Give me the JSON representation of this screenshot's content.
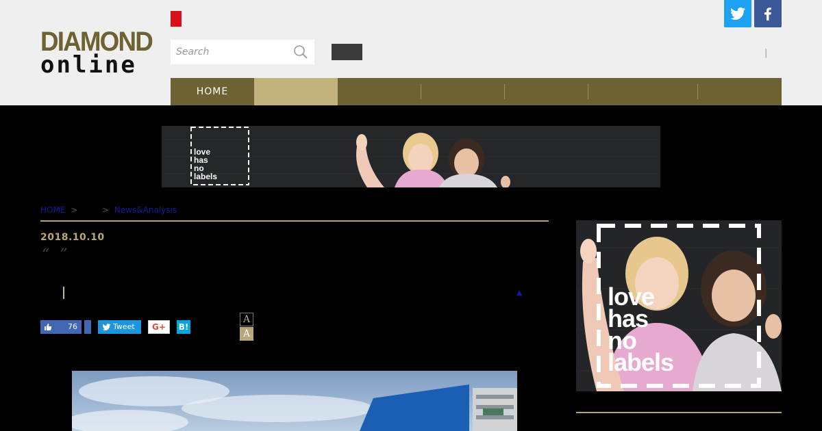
{
  "header": {
    "logo_line1": "DIAMOND",
    "logo_line2": "online",
    "search_placeholder": "Search",
    "separator": "|"
  },
  "nav": {
    "items": [
      {
        "label": "HOME",
        "active": false
      },
      {
        "label": "",
        "active": true
      },
      {
        "label": "",
        "active": false
      },
      {
        "label": "",
        "active": false
      },
      {
        "label": "",
        "active": false
      },
      {
        "label": "",
        "active": false
      },
      {
        "label": "",
        "active": false
      }
    ]
  },
  "ads": {
    "banner_text": [
      "love",
      "has",
      "no",
      "labels"
    ],
    "sidebar_text": [
      "love",
      "has",
      "no",
      "labels"
    ]
  },
  "breadcrumb": {
    "home": "HOME",
    "sep": ">",
    "section": "News&Analysis"
  },
  "article": {
    "date": "2018.10.10",
    "quote_marks": "“ ”",
    "up_arrow": "▲"
  },
  "social": {
    "like_count": "76",
    "tweet_label": "Tweet",
    "gplus_label": "G+",
    "hatena_label": "B!"
  },
  "font_size": {
    "large_label": "A",
    "small_label": "A"
  },
  "colors": {
    "brand": "#6e6232",
    "accent": "#c3b27b",
    "header_bg": "#efefef",
    "page_bg": "#000000",
    "twitter": "#1da1f2",
    "facebook": "#3b5998"
  }
}
